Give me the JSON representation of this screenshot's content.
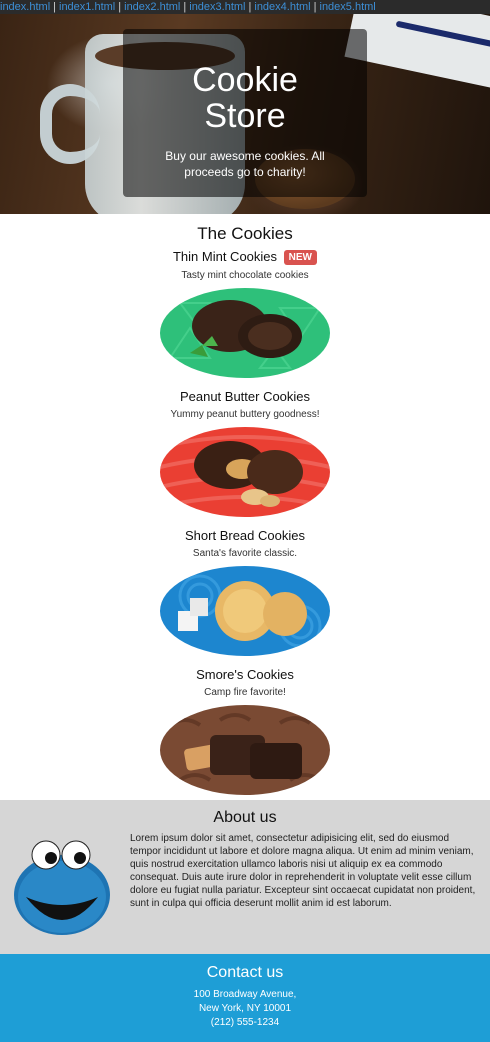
{
  "nav": {
    "links": [
      "index.html",
      "index1.html",
      "index2.html",
      "index3.html",
      "index4.html",
      "index5.html"
    ]
  },
  "hero": {
    "title_line1": "Cookie",
    "title_line2": "Store",
    "subtitle": "Buy our awesome cookies. All proceeds go to charity!"
  },
  "cookies": {
    "heading": "The Cookies",
    "items": [
      {
        "name": "Thin Mint Cookies",
        "badge": "NEW",
        "desc": "Tasty mint chocolate cookies",
        "bg": "#2ec07a"
      },
      {
        "name": "Peanut Butter Cookies",
        "badge": "",
        "desc": "Yummy peanut buttery goodness!",
        "bg": "#ea3f33"
      },
      {
        "name": "Short Bread Cookies",
        "badge": "",
        "desc": "Santa's favorite classic.",
        "bg": "#1d86cf"
      },
      {
        "name": "Smore's Cookies",
        "badge": "",
        "desc": "Camp fire favorite!",
        "bg": "#7a4a33"
      }
    ]
  },
  "about": {
    "heading": "About us",
    "body": "Lorem ipsum dolor sit amet, consectetur adipisicing elit, sed do eiusmod tempor incididunt ut labore et dolore magna aliqua. Ut enim ad minim veniam, quis nostrud exercitation ullamco laboris nisi ut aliquip ex ea commodo consequat. Duis aute irure dolor in reprehenderit in voluptate velit esse cillum dolore eu fugiat nulla pariatur. Excepteur sint occaecat cupidatat non proident, sunt in culpa qui officia deserunt mollit anim id est laborum."
  },
  "contact": {
    "heading": "Contact us",
    "address1": "100 Broadway Avenue,",
    "address2": "New York, NY 10001",
    "phone": "(212) 555-1234"
  }
}
